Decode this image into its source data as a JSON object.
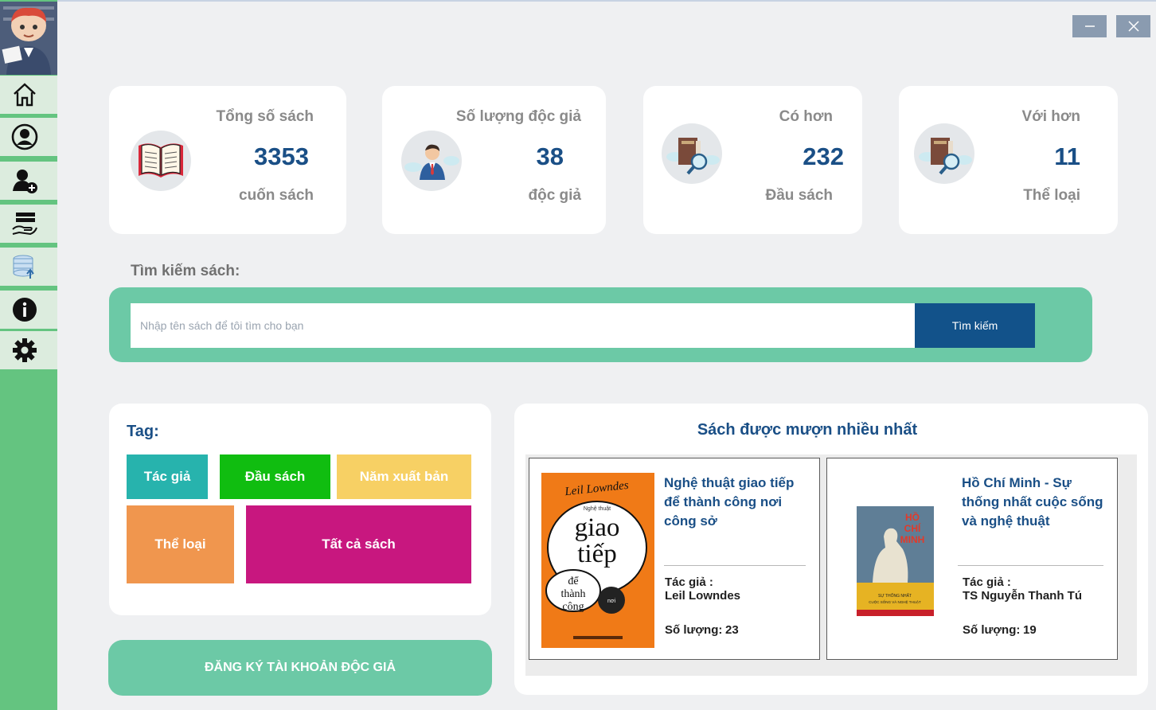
{
  "sidebar": {
    "items": [
      {
        "icon": "home-icon"
      },
      {
        "icon": "user-icon"
      },
      {
        "icon": "add-user-icon"
      },
      {
        "icon": "lend-book-icon"
      },
      {
        "icon": "database-upload-icon"
      },
      {
        "icon": "info-icon"
      },
      {
        "icon": "gear-icon"
      }
    ]
  },
  "window": {
    "minimize": "−",
    "close": "✕"
  },
  "stats": [
    {
      "label": "Tổng số sách",
      "value": "3353",
      "unit": "cuốn sách",
      "icon": "open-book-icon"
    },
    {
      "label": "Số lượng độc giả",
      "value": "38",
      "unit": "độc giả",
      "icon": "reader-icon"
    },
    {
      "label": "Có hơn",
      "value": "232",
      "unit": "Đầu sách",
      "icon": "book-search-icon"
    },
    {
      "label": "Với hơn",
      "value": "11",
      "unit": "Thể loại",
      "icon": "book-search-icon"
    }
  ],
  "search": {
    "title": "Tìm kiếm sách:",
    "placeholder": "Nhập tên sách để tôi tìm cho bạn",
    "button": "Tìm kiếm"
  },
  "tags": {
    "title": "Tag:",
    "items": [
      {
        "label": "Tác giả",
        "color": "#27b3ad"
      },
      {
        "label": "Đầu sách",
        "color": "#10bd10"
      },
      {
        "label": "Năm xuất bản",
        "color": "#f7d064"
      },
      {
        "label": "Thể loại",
        "color": "#f0964e"
      },
      {
        "label": "Tất cả sách",
        "color": "#c8177f"
      }
    ]
  },
  "register_button": "ĐĂNG KÝ TÀI KHOẢN ĐỘC GIẢ",
  "most_borrowed": {
    "title": "Sách được mượn nhiều nhất",
    "books": [
      {
        "title": "Nghệ thuật giao tiếp để thành công nơi công sở",
        "author_label": "Tác giả :",
        "author": "Leil Lowndes",
        "qty_label": "Số lượng:",
        "qty": "23",
        "cover": {
          "author": "Leil Lowndes",
          "line1": "giao",
          "line2": "tiếp",
          "line3": "để thành công",
          "small": "Nghệ thuật",
          "color": "#f07a17"
        }
      },
      {
        "title": "Hồ Chí Minh - Sự thống nhất cuộc sống và nghệ thuật",
        "author_label": "Tác giả :",
        "author": "TS Nguyễn Thanh Tú",
        "qty_label": "Số lượng:",
        "qty": "19",
        "cover": {
          "line1": "HỒ",
          "line2": "CHÍ",
          "line3": "MINH",
          "small": "SỰ THỐNG NHẤT CUỘC SỐNG VÀ NGHỆ THUẬT",
          "color": "#1f3550"
        }
      }
    ]
  }
}
